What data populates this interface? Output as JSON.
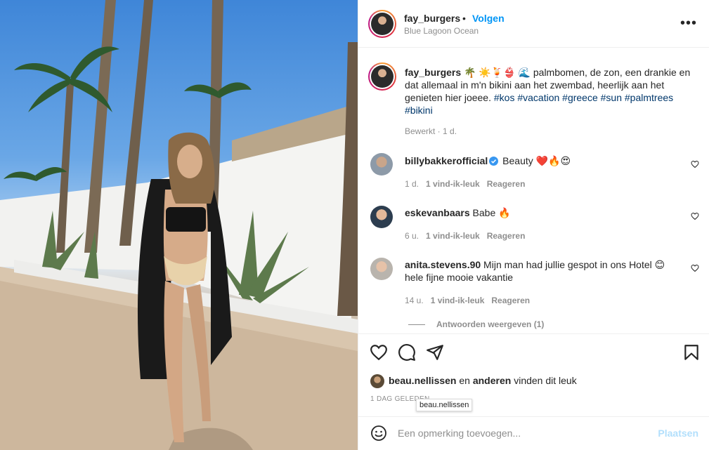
{
  "post": {
    "username": "fay_burgers",
    "dot": "•",
    "follow_label": "Volgen",
    "location": "Blue Lagoon Ocean",
    "more_label": "•••"
  },
  "caption": {
    "username": "fay_burgers",
    "text": " 🌴 ☀️🍹👙 🌊 palmbomen, de zon, een drankie en dat allemaal in m'n bikini aan het zwembad, heerlijk aan het genieten hier joeee. ",
    "hashtags": "#kos #vacation #greece #sun #palmtrees #bikini",
    "meta": "Bewerkt · 1 d."
  },
  "comments": [
    {
      "username": "billybakkerofficial",
      "verified": true,
      "text": " Beauty ❤️🔥😍",
      "time": "1 d.",
      "likes": "1 vind-ik-leuk",
      "reply": "Reageren"
    },
    {
      "username": "eskevanbaars",
      "verified": false,
      "text": " Babe 🔥",
      "time": "6 u.",
      "likes": "1 vind-ik-leuk",
      "reply": "Reageren"
    },
    {
      "username": "anita.stevens.90",
      "verified": false,
      "text": " Mijn man had jullie gespot in ons Hotel 😊 hele fijne mooie vakantie",
      "time": "14 u.",
      "likes": "1 vind-ik-leuk",
      "reply": "Reageren"
    }
  ],
  "view_replies": "Antwoorden weergeven (1)",
  "likes": {
    "user": "beau.nellissen",
    "connector": " en ",
    "others": "anderen",
    "suffix": " vinden dit leuk"
  },
  "date": "1 DAG GELEDEN",
  "tooltip": "beau.nellissen",
  "comment_box": {
    "placeholder": "Een opmerking toevoegen...",
    "post_label": "Plaatsen"
  },
  "colors": {
    "link_blue": "#0095f6",
    "hashtag": "#00376b",
    "muted": "#8e8e8e",
    "post_disabled": "#b2dffc"
  }
}
